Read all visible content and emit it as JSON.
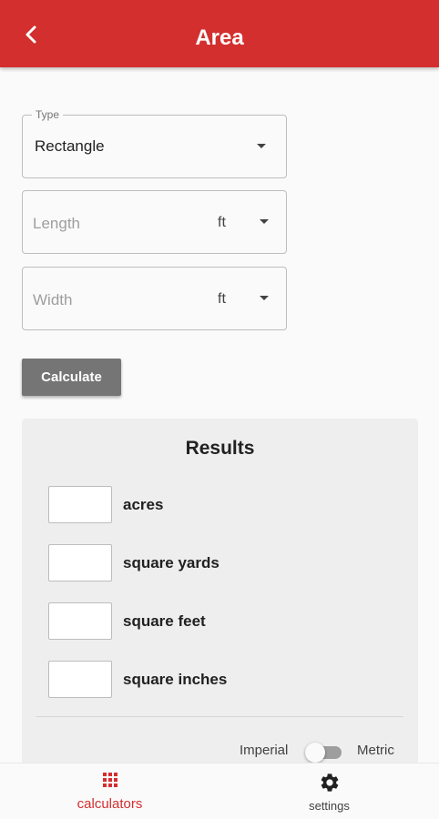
{
  "app_bar": {
    "title": "Area",
    "back_icon": "chevron-left-icon",
    "color": "#d32f2f"
  },
  "form": {
    "type": {
      "legend": "Type",
      "value": "Rectangle"
    },
    "length": {
      "placeholder": "Length",
      "unit": "ft"
    },
    "width": {
      "placeholder": "Width",
      "unit": "ft"
    },
    "calculate_label": "Calculate"
  },
  "results": {
    "title": "Results",
    "items": [
      {
        "label": "acres",
        "value": ""
      },
      {
        "label": "square yards",
        "value": ""
      },
      {
        "label": "square feet",
        "value": ""
      },
      {
        "label": "square inches",
        "value": ""
      }
    ],
    "toggle": {
      "left_label": "Imperial",
      "right_label": "Metric",
      "selected": "Imperial"
    }
  },
  "bottom_nav": {
    "items": [
      {
        "label": "calculators",
        "icon": "grid-icon",
        "active": true,
        "color": "#d32f2f"
      },
      {
        "label": "settings",
        "icon": "gear-icon",
        "active": false
      }
    ]
  }
}
